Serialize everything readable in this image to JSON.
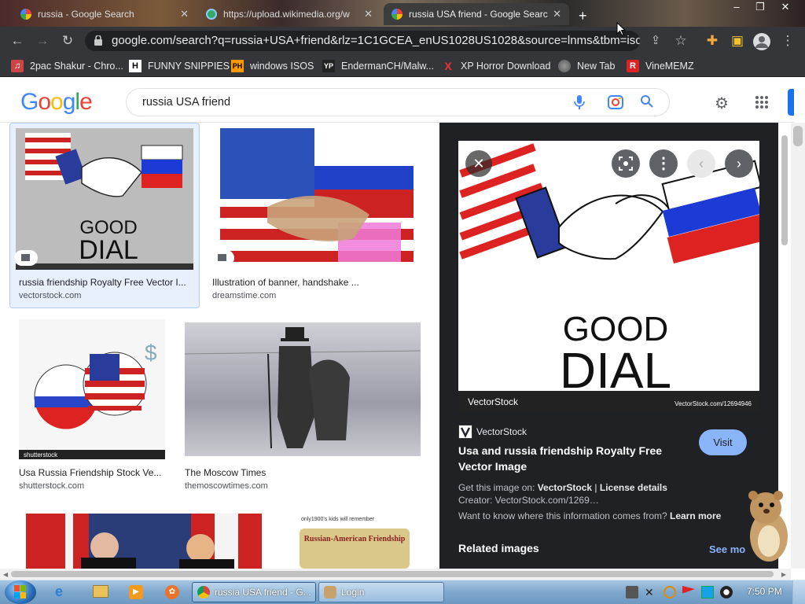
{
  "browser": {
    "tabs": [
      {
        "title": "russia - Google Search",
        "close": "✕"
      },
      {
        "title": "https://upload.wikimedia.org/w",
        "close": "✕"
      },
      {
        "title": "russia USA friend - Google Search",
        "close": "✕"
      }
    ],
    "url": "google.com/search?q=russia+USA+friend&rlz=1C1GCEA_enUS1028US1028&source=lnms&tbm=isch&sa=...",
    "bookmarks": [
      {
        "label": "2pac Shakur - Chro...",
        "icon": "H"
      },
      {
        "label": "FUNNY SNIPPIES",
        "icon": "H"
      },
      {
        "label": "windows ISOS",
        "icon": "PH"
      },
      {
        "label": "EndermanCH/Malw...",
        "icon": "YP"
      },
      {
        "label": "XP Horror Download",
        "icon": "X"
      },
      {
        "label": "New Tab",
        "icon": "globe"
      },
      {
        "label": "VineMEMZ",
        "icon": "R"
      }
    ]
  },
  "google": {
    "logo": "Google",
    "query": "russia USA friend"
  },
  "results": [
    {
      "title": "russia friendship Royalty Free Vector I...",
      "source": "vectorstock.com",
      "image_text_1": "GOOD",
      "image_text_2": "DIAL",
      "watermark": "VectorStock"
    },
    {
      "title": "Illustration of banner, handshake ...",
      "source": "dreamstime.com"
    },
    {
      "title": "Usa Russia Friendship Stock Ve...",
      "source": "shutterstock.com",
      "watermark": "shutterstock"
    },
    {
      "title": "The Moscow Times",
      "source": "themoscowtimes.com"
    },
    {
      "title": "",
      "source": ""
    },
    {
      "title": "",
      "source": "",
      "image_caption": "Russian-American Friendship",
      "image_top": "only1900's kids will remember"
    }
  ],
  "panel": {
    "image_text_1": "GOOD",
    "image_text_2": "DIAL",
    "image_brand": "VectorStock",
    "image_url": "VectorStock.com/12694946",
    "site_name": "VectorStock",
    "title_line1": "Usa and russia friendship Royalty Free",
    "title_line2": "Vector Image",
    "visit": "Visit",
    "get_image_prefix": "Get this image on: ",
    "get_image_site": "VectorStock",
    "license": "License details",
    "creator": "Creator: VectorStock.com/1269…",
    "want_to_know": "Want to know where this information comes from? ",
    "learn_more": "Learn more",
    "related": "Related images",
    "see_more": "See mo"
  },
  "taskbar": {
    "apps": [
      {
        "label": "russia USA friend - G..."
      },
      {
        "label": "Login"
      }
    ],
    "time": "7:50 PM"
  }
}
